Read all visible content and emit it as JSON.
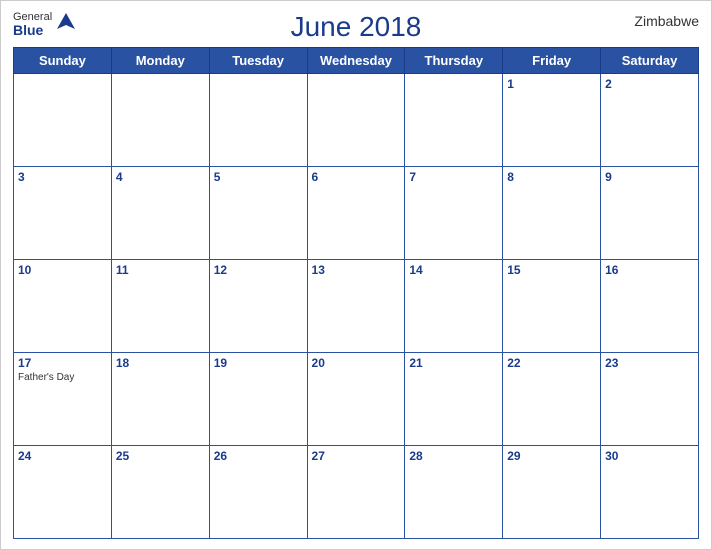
{
  "header": {
    "title": "June 2018",
    "country": "Zimbabwe",
    "logo": {
      "general": "General",
      "blue": "Blue"
    }
  },
  "weekdays": [
    "Sunday",
    "Monday",
    "Tuesday",
    "Wednesday",
    "Thursday",
    "Friday",
    "Saturday"
  ],
  "weeks": [
    [
      {
        "day": "",
        "event": ""
      },
      {
        "day": "",
        "event": ""
      },
      {
        "day": "",
        "event": ""
      },
      {
        "day": "",
        "event": ""
      },
      {
        "day": "",
        "event": ""
      },
      {
        "day": "1",
        "event": ""
      },
      {
        "day": "2",
        "event": ""
      }
    ],
    [
      {
        "day": "3",
        "event": ""
      },
      {
        "day": "4",
        "event": ""
      },
      {
        "day": "5",
        "event": ""
      },
      {
        "day": "6",
        "event": ""
      },
      {
        "day": "7",
        "event": ""
      },
      {
        "day": "8",
        "event": ""
      },
      {
        "day": "9",
        "event": ""
      }
    ],
    [
      {
        "day": "10",
        "event": ""
      },
      {
        "day": "11",
        "event": ""
      },
      {
        "day": "12",
        "event": ""
      },
      {
        "day": "13",
        "event": ""
      },
      {
        "day": "14",
        "event": ""
      },
      {
        "day": "15",
        "event": ""
      },
      {
        "day": "16",
        "event": ""
      }
    ],
    [
      {
        "day": "17",
        "event": "Father's Day"
      },
      {
        "day": "18",
        "event": ""
      },
      {
        "day": "19",
        "event": ""
      },
      {
        "day": "20",
        "event": ""
      },
      {
        "day": "21",
        "event": ""
      },
      {
        "day": "22",
        "event": ""
      },
      {
        "day": "23",
        "event": ""
      }
    ],
    [
      {
        "day": "24",
        "event": ""
      },
      {
        "day": "25",
        "event": ""
      },
      {
        "day": "26",
        "event": ""
      },
      {
        "day": "27",
        "event": ""
      },
      {
        "day": "28",
        "event": ""
      },
      {
        "day": "29",
        "event": ""
      },
      {
        "day": "30",
        "event": ""
      }
    ]
  ]
}
